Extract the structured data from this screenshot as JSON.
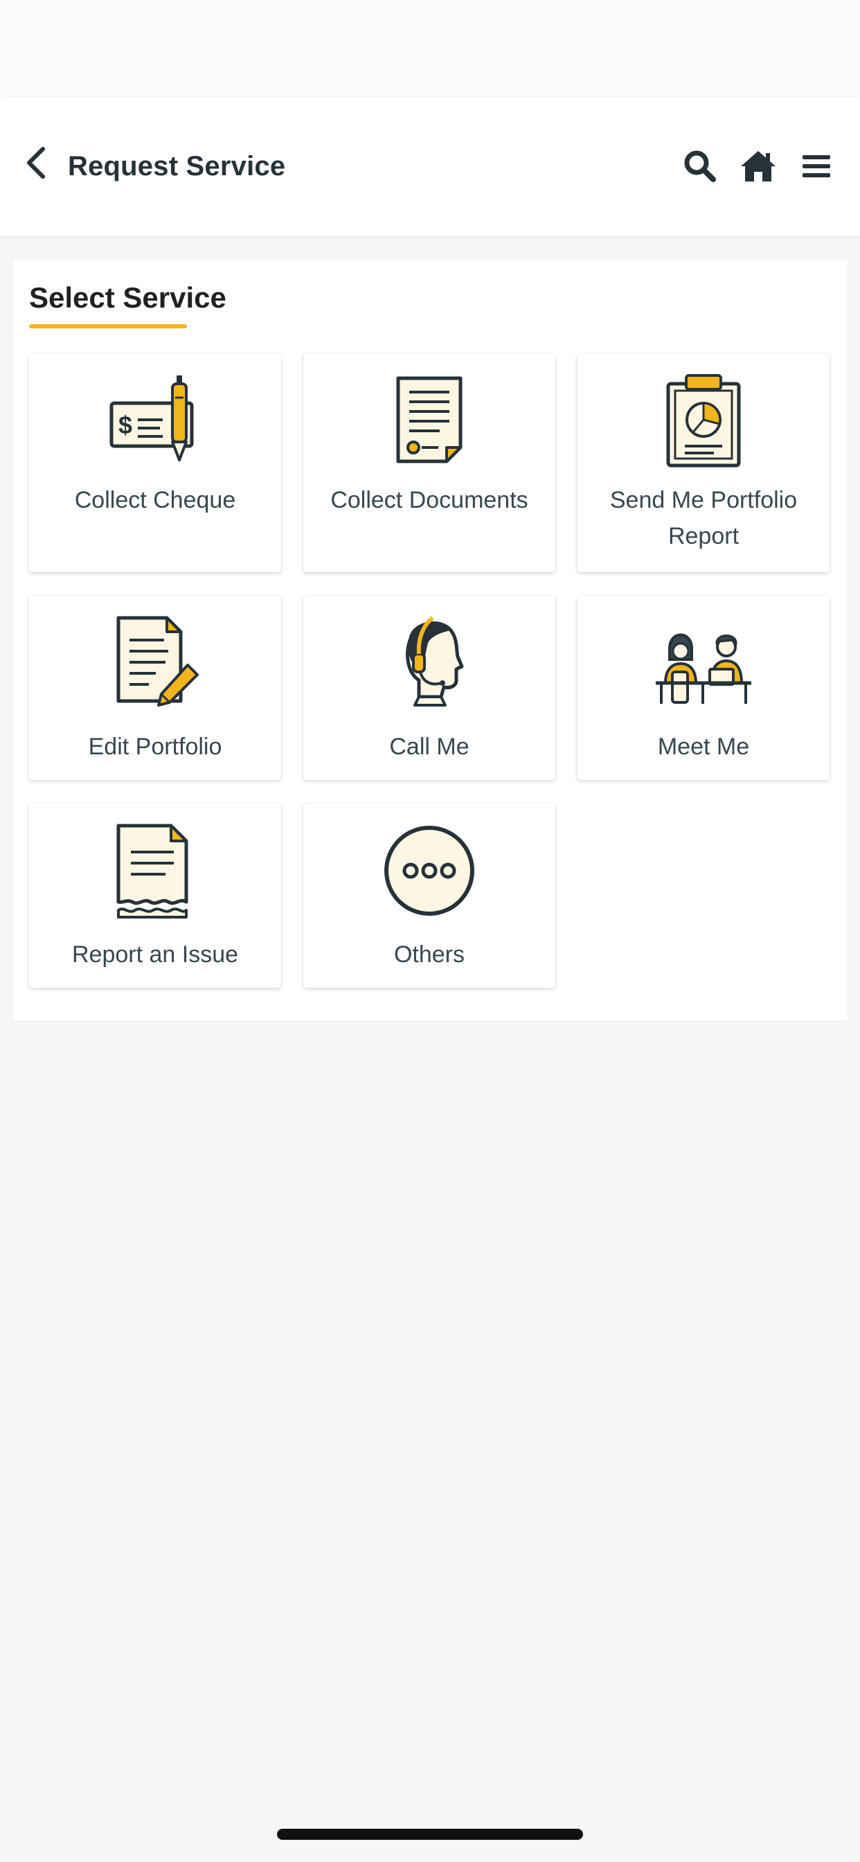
{
  "header": {
    "title": "Request Service",
    "icons": [
      "back-chevron-icon",
      "search-icon",
      "home-icon",
      "hamburger-menu-icon"
    ]
  },
  "section": {
    "title": "Select Service",
    "accent_color": "#f2b51c"
  },
  "services": [
    {
      "label": "Collect Cheque",
      "icon": "cheque-pen-icon"
    },
    {
      "label": "Collect Documents",
      "icon": "document-icon"
    },
    {
      "label": "Send Me Portfolio Report",
      "icon": "clipboard-pie-chart-icon"
    },
    {
      "label": "Edit Portfolio",
      "icon": "edit-document-pencil-icon"
    },
    {
      "label": "Call Me",
      "icon": "headset-agent-icon"
    },
    {
      "label": "Meet Me",
      "icon": "meeting-people-icon"
    },
    {
      "label": "Report an Issue",
      "icon": "torn-paper-icon"
    },
    {
      "label": "Others",
      "icon": "more-dots-icon"
    }
  ]
}
